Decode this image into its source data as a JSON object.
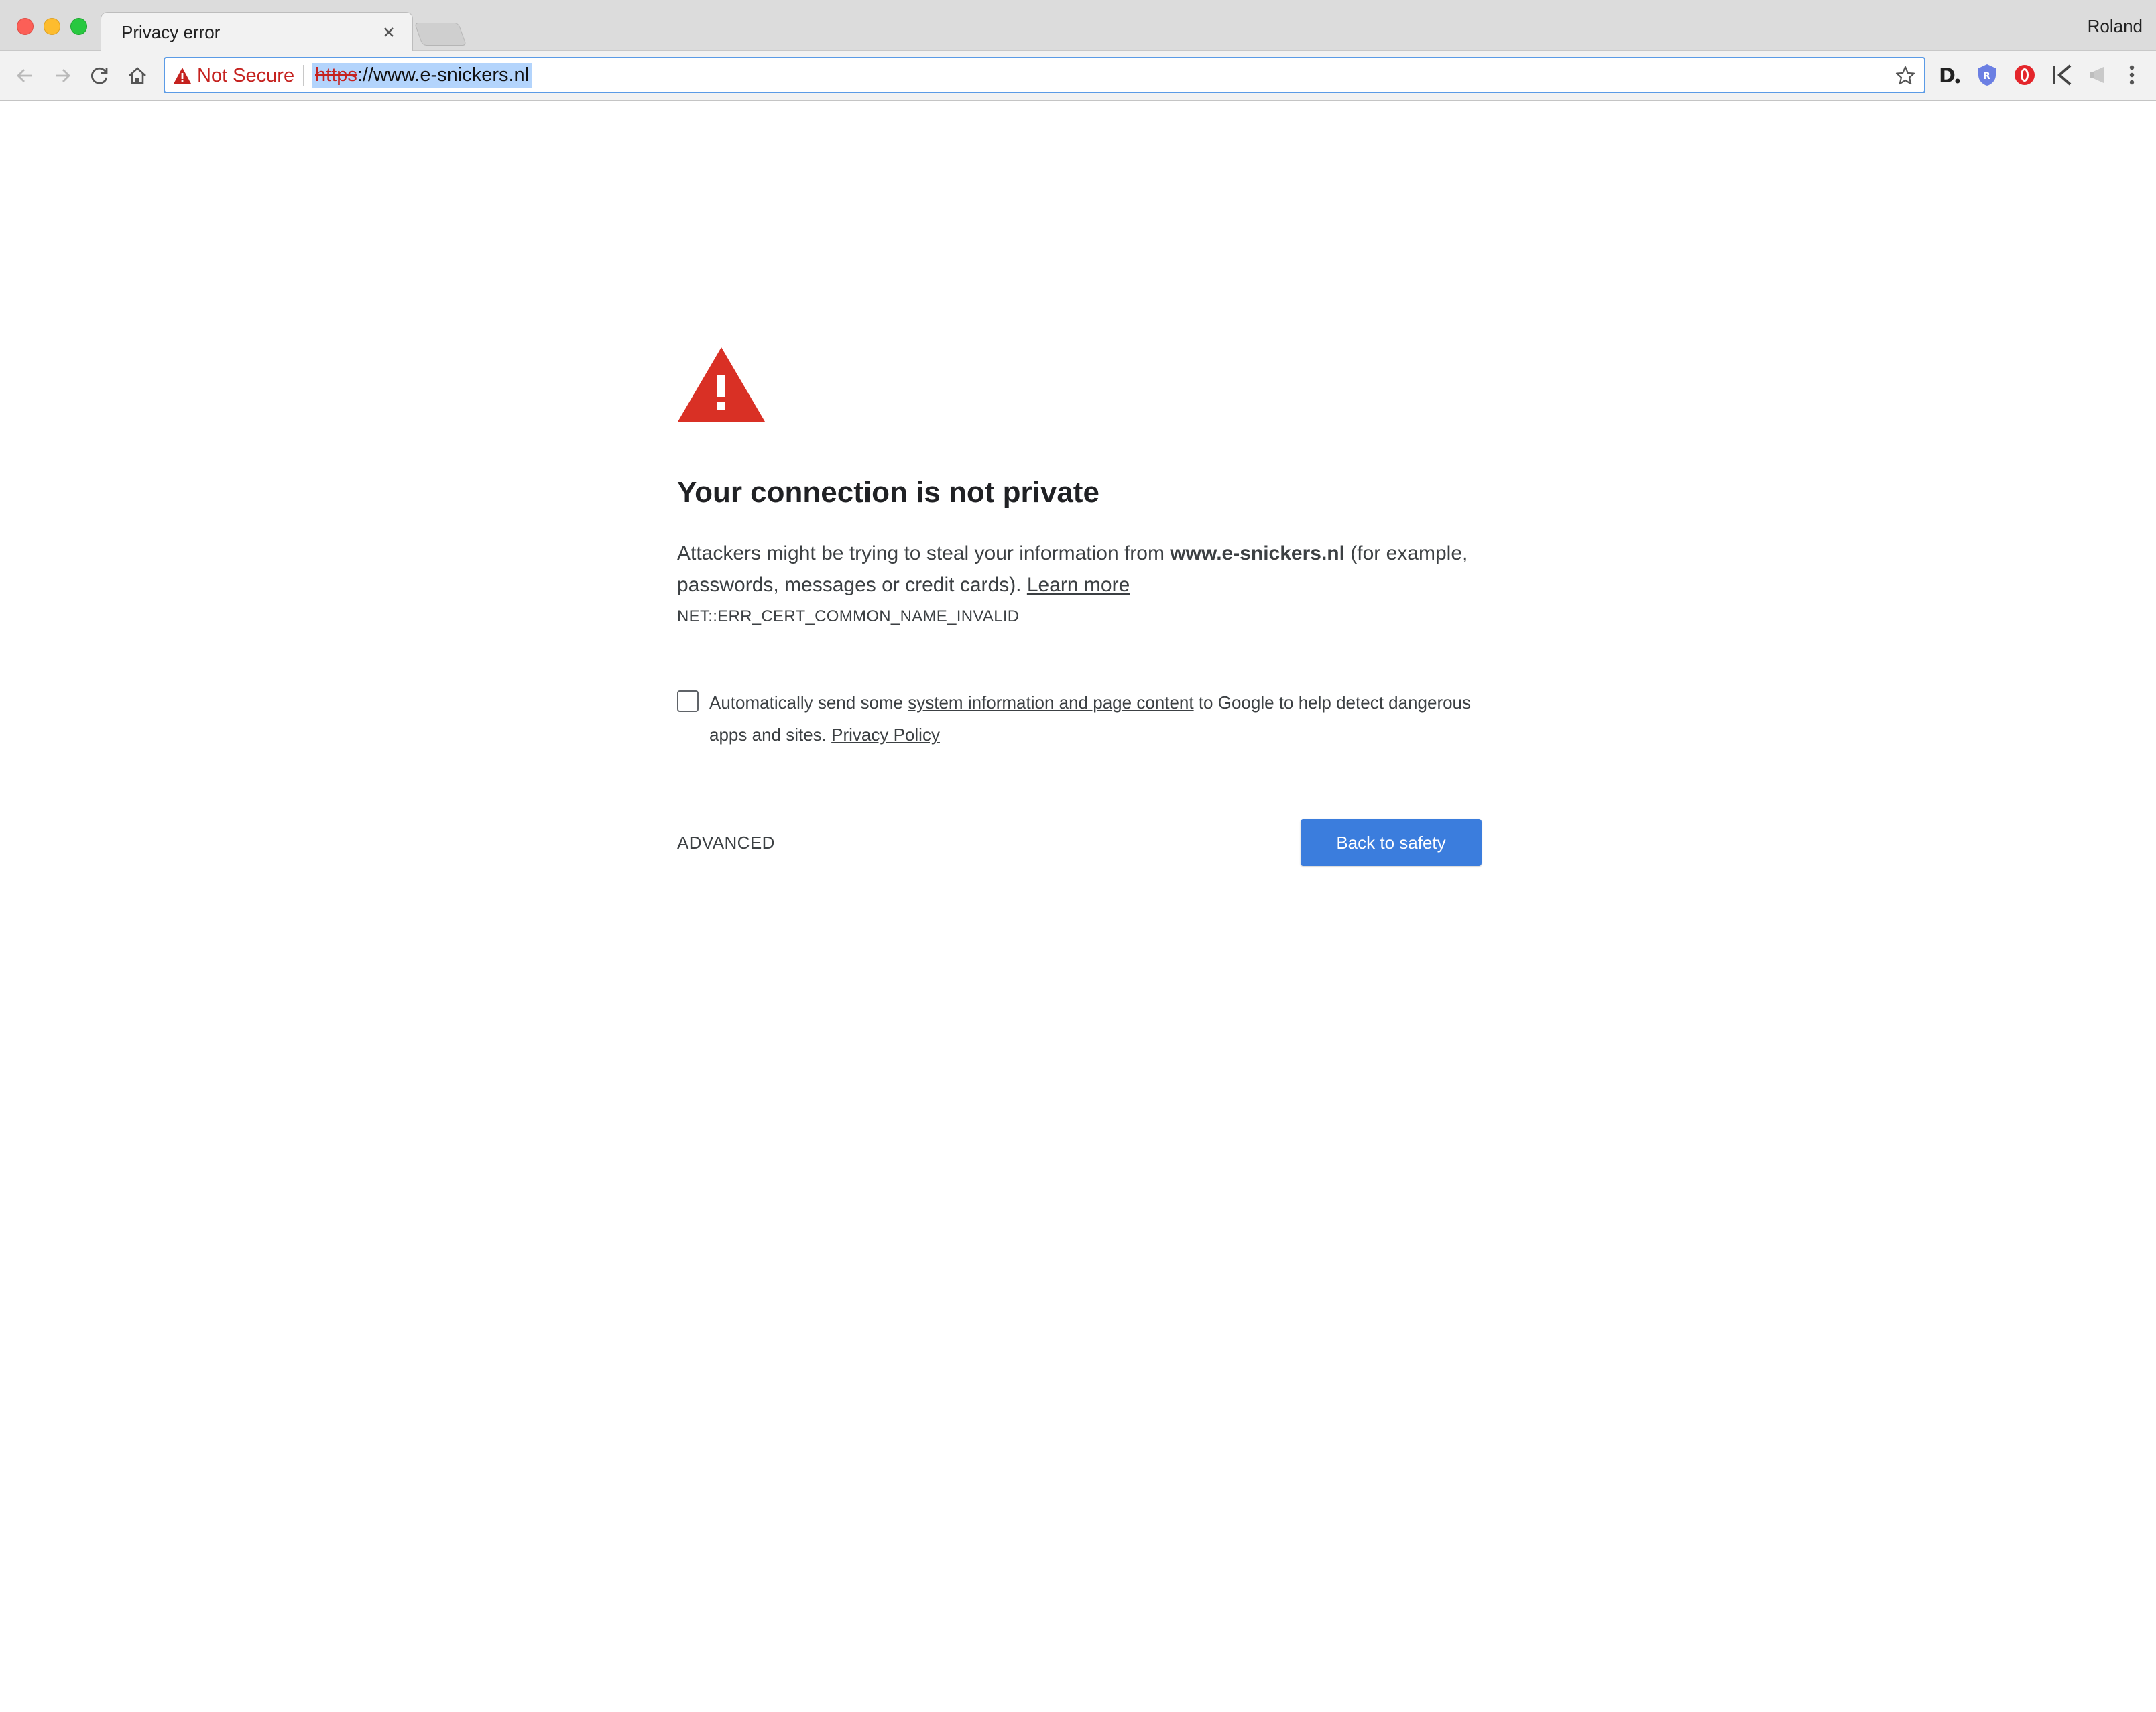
{
  "window": {
    "profile_name": "Roland"
  },
  "tab": {
    "title": "Privacy error"
  },
  "omnibox": {
    "security_label": "Not Secure",
    "url_scheme": "https",
    "url_rest": "://www.e-snickers.nl"
  },
  "interstitial": {
    "heading": "Your connection is not private",
    "explanation_prefix": "Attackers might be trying to steal your information from ",
    "host": "www.e-snickers.nl",
    "explanation_suffix": " (for example, passwords, messages or credit cards). ",
    "learn_more": "Learn more",
    "error_code": "NET::ERR_CERT_COMMON_NAME_INVALID",
    "optin_prefix": "Automatically send some ",
    "optin_link": "system information and page content",
    "optin_middle": " to Google to help detect dangerous apps and sites. ",
    "privacy_policy": "Privacy Policy",
    "advanced": "ADVANCED",
    "back_to_safety": "Back to safety"
  },
  "icons": {
    "back": "arrow-left-icon",
    "forward": "arrow-right-icon",
    "reload": "reload-icon",
    "home": "home-icon",
    "bookmark": "star-icon",
    "menu": "three-dot-menu-icon"
  },
  "colors": {
    "warning_red": "#d93025",
    "not_secure_red": "#c5221f",
    "primary_button": "#3b7ddd",
    "omnibox_focus": "#5b9be6",
    "url_selection": "#b3d4fc"
  }
}
